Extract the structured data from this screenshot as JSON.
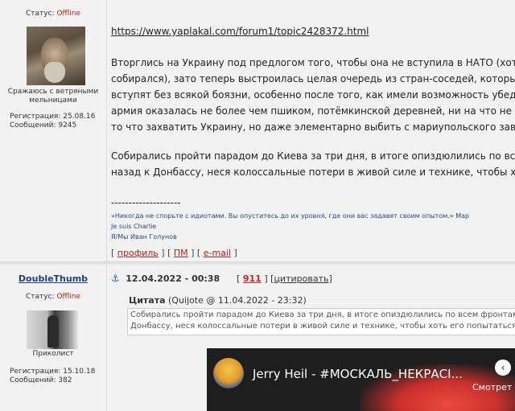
{
  "post1": {
    "status_label": "Статус:",
    "status_value": "Offline",
    "user_caption_line1": "Сражаюсь с ветряными",
    "user_caption_line2": "мельницами",
    "reg_line": "Регистрация: 25.08.16",
    "msgs_line": "Сообщений: 9245",
    "link": "https://www.yaplakal.com/forum1/topic2428372.html",
    "body_lines": [
      "Вторглись на Украину под предлогом того, чтобы она не вступила в НАТО (хотя",
      "собирался), зато теперь выстроилась целая очередь из стран-соседей, которые",
      "вступят без всякой боязни, особенно после того, как имели возможность убедит",
      "армия оказалась не более чем пшиком, потёмкинской деревней, ни на что не сп",
      "то что захватить Украину, но даже элементарно выбить с мариупольского завод"
    ],
    "body_lines2": [
      "Собирались пройти парадом до Киева за три дня, в итоге опиздюлились по всем",
      "назад к Донбассу, неся колоссальные потери в живой силе и технике, чтобы хот"
    ],
    "signature_rule": "--------------------",
    "signature": [
      "«Никогда не спорьте с идиотами. Вы опуститесь до их уровня, где они вас задавят своим опытом.» Мар",
      "Je suis Charlie",
      "Я/Мы Иван Голунов"
    ],
    "actions": {
      "open": "[",
      "profile": "профиль",
      "sep1": "] [",
      "pm": "ПМ",
      "sep2": "] [",
      "email": "e-mail",
      "close": "]"
    }
  },
  "post2": {
    "username": "DoubleThumb",
    "status_label": "Статус:",
    "status_value": "Offline",
    "user_caption": "Приколист",
    "reg_line": "Регистрация: 15.10.18",
    "msgs_line": "Сообщений: 382",
    "anchor_icon": "⚓",
    "date": "12.04.2022 - 00:38",
    "post_num_open": "[",
    "post_num": "911",
    "post_num_close": "]",
    "quote_open": "[",
    "quote_action": "цитировать",
    "quote_close": "]",
    "quote_title": "Цитата",
    "quote_meta": "(Quijote @ 11.04.2022 - 23:32)",
    "quote_lines": [
      "Собирались пройти парадом до Киева за три дня, в итоге опиздюлились по всем фронтам",
      "Донбассу, неся колоссальные потери в живой силе и технике, чтобы хоть его попытаться"
    ],
    "video": {
      "title": "Jerry Heil - #МОСКАЛЬ_НЕКРАСІ...",
      "share_label": "Смотрет",
      "share_icon": "‹"
    }
  }
}
